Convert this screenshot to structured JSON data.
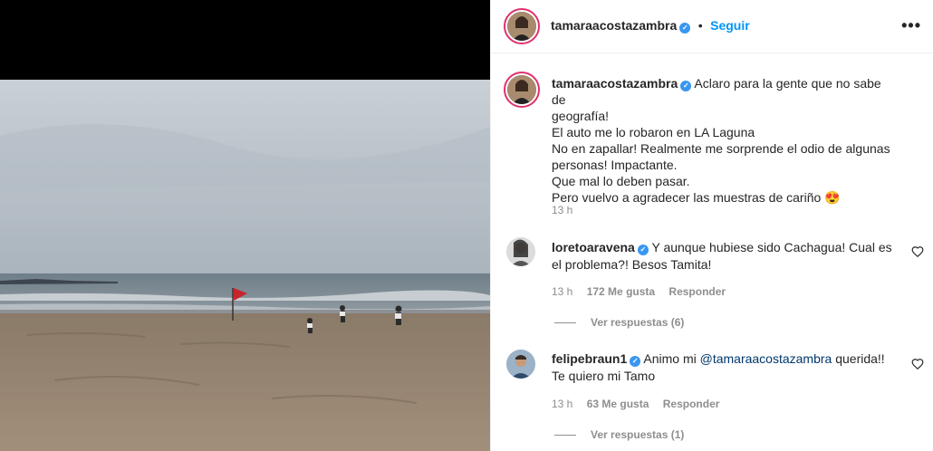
{
  "post_author": {
    "username": "tamaraacostazambra",
    "verified": true,
    "follow_label": "Seguir"
  },
  "caption": {
    "username": "tamaraacostazambra",
    "lines": [
      "Aclaro para la gente que no sabe de",
      "geografía!",
      "El auto me lo robaron en LA Laguna",
      "No en zapallar! Realmente me sorprende el odio de algunas",
      "personas! Impactante.",
      "Que mal lo deben pasar.",
      "Pero vuelvo a agradecer las muestras de cariño 😍"
    ],
    "time": "13 h"
  },
  "comments": [
    {
      "username": "loretoaravena",
      "verified": true,
      "text": "Y aunque hubiese sido Cachagua! Cual es el problema?! Besos Tamita!",
      "time": "13 h",
      "likes": "172 Me gusta",
      "reply_label": "Responder",
      "view_replies": "Ver respuestas (6)"
    },
    {
      "username": "felipebraun1",
      "verified": true,
      "text_before": "Animo mi ",
      "mention": "@tamaraacostazambra",
      "text_after": " querida!! Te quiero mi Tamo",
      "time": "13 h",
      "likes": "63 Me gusta",
      "reply_label": "Responder",
      "view_replies": "Ver respuestas (1)"
    }
  ],
  "icons": {
    "more": "more-options-icon",
    "verified": "verified-badge-icon",
    "heart": "heart-icon"
  },
  "colors": {
    "link": "#0095f6",
    "verified": "#3897f0",
    "muted": "#8e8e8e",
    "text": "#262626"
  }
}
